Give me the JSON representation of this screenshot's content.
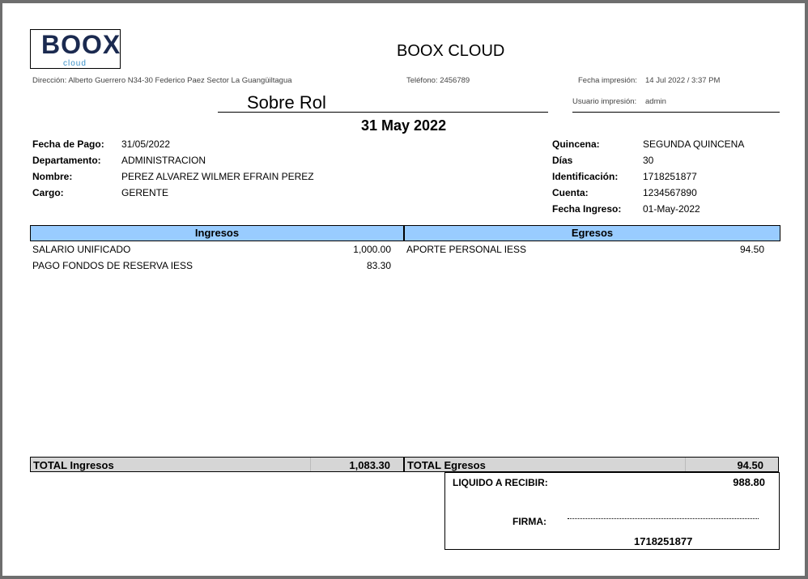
{
  "header": {
    "logo_text": "BOOX",
    "logo_sub": "cloud",
    "company": "BOOX CLOUD",
    "address": "Dirección: Alberto Guerrero N34-30 Federico Paez Sector La Guangüiltagua",
    "phone": "Teléfono: 2456789",
    "print_date_label": "Fecha impresión:",
    "print_date": "14 Jul 2022 / 3:37 PM",
    "print_user_label": "Usuario impresión:",
    "print_user": "admin",
    "title": "Sobre Rol",
    "date_title": "31 May 2022"
  },
  "info_left": [
    {
      "label": "Fecha de Pago:",
      "value": "31/05/2022"
    },
    {
      "label": "Departamento:",
      "value": "ADMINISTRACION"
    },
    {
      "label": "Nombre:",
      "value": "PEREZ ALVAREZ WILMER EFRAIN PEREZ"
    },
    {
      "label": "Cargo:",
      "value": "GERENTE"
    }
  ],
  "info_right": [
    {
      "label": "Quincena:",
      "value": "SEGUNDA QUINCENA"
    },
    {
      "label": "Días",
      "value": "30"
    },
    {
      "label": "Identificación:",
      "value": "1718251877"
    },
    {
      "label": "Cuenta:",
      "value": "1234567890"
    },
    {
      "label": "Fecha Ingreso:",
      "value": "01-May-2022"
    }
  ],
  "ingresos": {
    "header": "Ingresos",
    "rows": [
      {
        "concept": "SALARIO UNIFICADO",
        "amount": "1,000.00"
      },
      {
        "concept": "PAGO FONDOS DE RESERVA IESS",
        "amount": "83.30"
      }
    ],
    "total_label": "TOTAL Ingresos",
    "total": "1,083.30"
  },
  "egresos": {
    "header": "Egresos",
    "rows": [
      {
        "concept": "APORTE PERSONAL IESS",
        "amount": "94.50"
      }
    ],
    "total_label": "TOTAL Egresos",
    "total": "94.50"
  },
  "summary": {
    "net_label": "LIQUIDO A RECIBIR:",
    "net": "988.80",
    "signature_label": "FIRMA:",
    "signature_id": "1718251877"
  }
}
